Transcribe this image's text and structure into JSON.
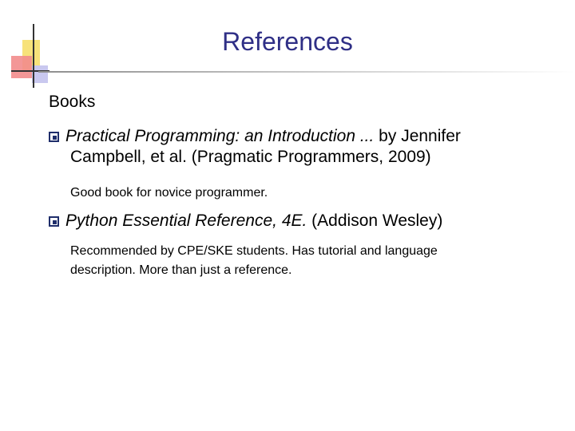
{
  "slide": {
    "title": "References",
    "section_label": "Books",
    "items": [
      {
        "title_italic": "Practical Programming: an Introduction ...",
        "rest_line1": " by Jennifer",
        "line2": "Campbell, et al. (Pragmatic Programmers, 2009)",
        "note": "Good book for novice programmer."
      },
      {
        "title_italic": "Python Essential Reference, 4E.",
        "rest": " (Addison Wesley)",
        "note_line1": "Recommended by CPE/SKE students. Has tutorial and language",
        "note_line2": "description. More than just a reference."
      }
    ],
    "colors": {
      "title": "#2f2f86",
      "bullet": "#1f2e6b",
      "accent_yellow": "#f7e27a",
      "accent_red": "#f28c8c",
      "accent_blue": "#c9c8ef"
    }
  }
}
